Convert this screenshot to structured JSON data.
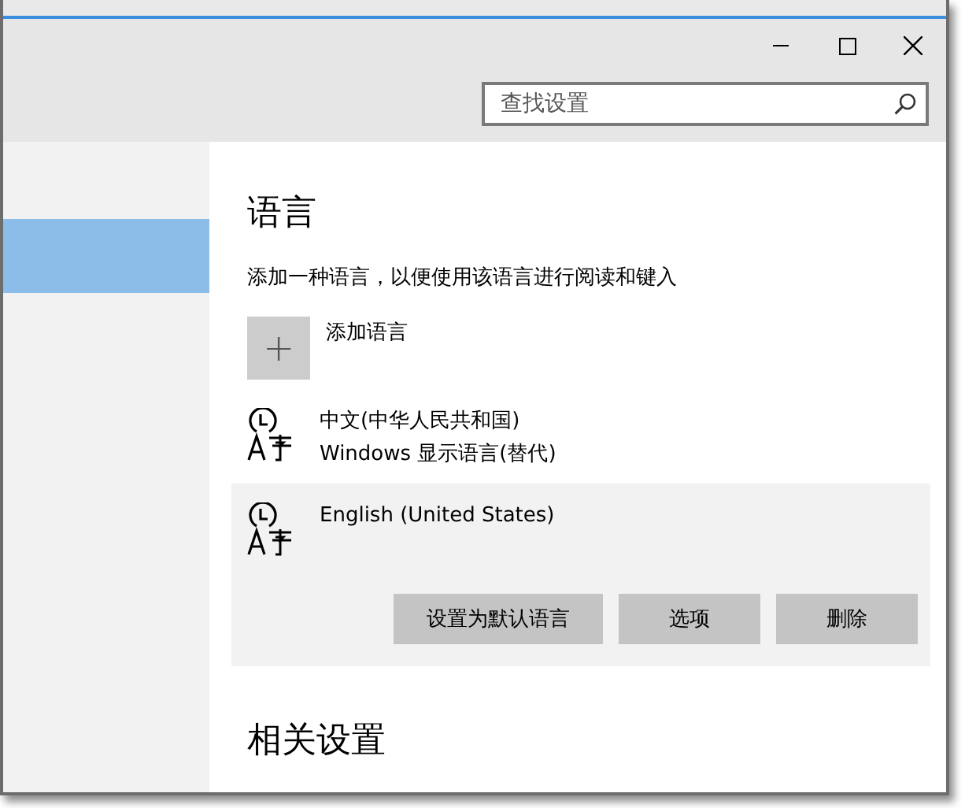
{
  "search": {
    "placeholder": "查找设置"
  },
  "page": {
    "heading": "语言",
    "description": "添加一种语言，以便使用该语言进行阅读和键入",
    "add_label": "添加语言",
    "add_icon": "+"
  },
  "languages": [
    {
      "name": "中文(中华人民共和国)",
      "detail": "Windows 显示语言(替代)",
      "selected": false
    },
    {
      "name": "English (United States)",
      "selected": true
    }
  ],
  "language_buttons": [
    "设置为默认语言",
    "选项",
    "删除"
  ],
  "related": {
    "heading": "相关设置"
  }
}
